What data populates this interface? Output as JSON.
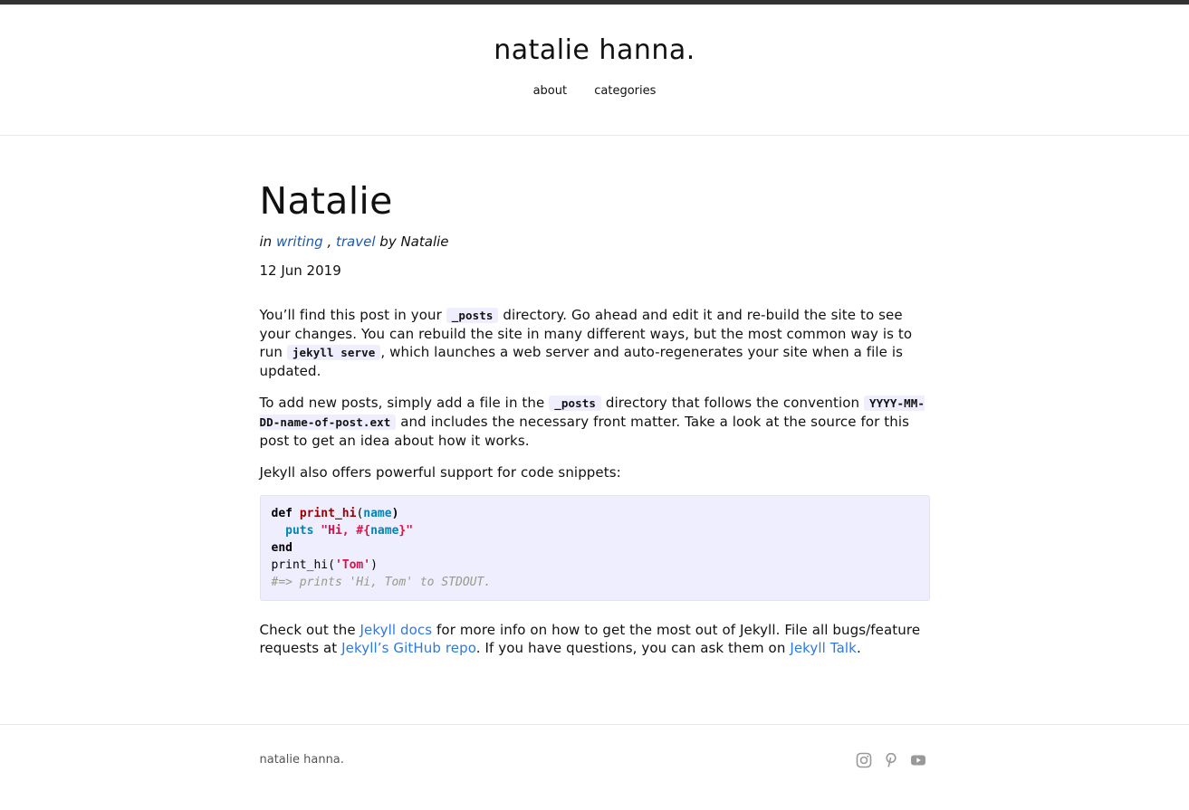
{
  "site": {
    "title": "natalie hanna."
  },
  "nav": [
    {
      "label": "about"
    },
    {
      "label": "categories"
    }
  ],
  "post": {
    "title": "Natalie",
    "meta_in": "in",
    "categories": [
      "writing",
      "travel"
    ],
    "meta_sep": ",",
    "meta_by": "by Natalie",
    "date": "12 Jun 2019",
    "p1": {
      "t1": "You’ll find this post in your ",
      "code1": "_posts",
      "t2": " directory. Go ahead and edit it and re-build the site to see your changes. You can rebuild the site in many different ways, but the most common way is to run ",
      "code2": "jekyll serve",
      "t3": ", which launches a web server and auto-regenerates your site when a file is updated."
    },
    "p2": {
      "t1": "To add new posts, simply add a file in the ",
      "code1": "_posts",
      "t2": " directory that follows the convention ",
      "code2": "YYYY-MM-DD-name-of-post.ext",
      "t3": " and includes the necessary front matter. Take a look at the source for this post to get an idea about how it works."
    },
    "p3": "Jekyll also offers powerful support for code snippets:",
    "code": {
      "l1_def": "def",
      "l1_fn": "print_hi",
      "l1_open": "(",
      "l1_arg": "name",
      "l1_close": ")",
      "l2_puts": "puts",
      "l2_str1": "\"Hi, #{",
      "l2_arg": "name",
      "l2_str2": "}\"",
      "l3_end": "end",
      "l4_call": "print_hi(",
      "l4_str": "'Tom'",
      "l4_close": ")",
      "l5_comment": "#=> prints 'Hi, Tom' to STDOUT."
    },
    "p4": {
      "t1": "Check out the ",
      "link1": "Jekyll docs",
      "t2": " for more info on how to get the most out of Jekyll. File all bugs/feature requests at ",
      "link2": "Jekyll’s GitHub repo",
      "t3": ". If you have questions, you can ask them on ",
      "link3": "Jekyll Talk",
      "t4": "."
    }
  },
  "footer": {
    "name": "natalie hanna.",
    "icons": [
      "instagram-icon",
      "pinterest-icon",
      "youtube-icon"
    ],
    "icon_color": "#999999"
  },
  "colors": {
    "link": "#2a7ae2",
    "category_link": "#1e5aa8",
    "code_bg": "#eeeeff"
  }
}
